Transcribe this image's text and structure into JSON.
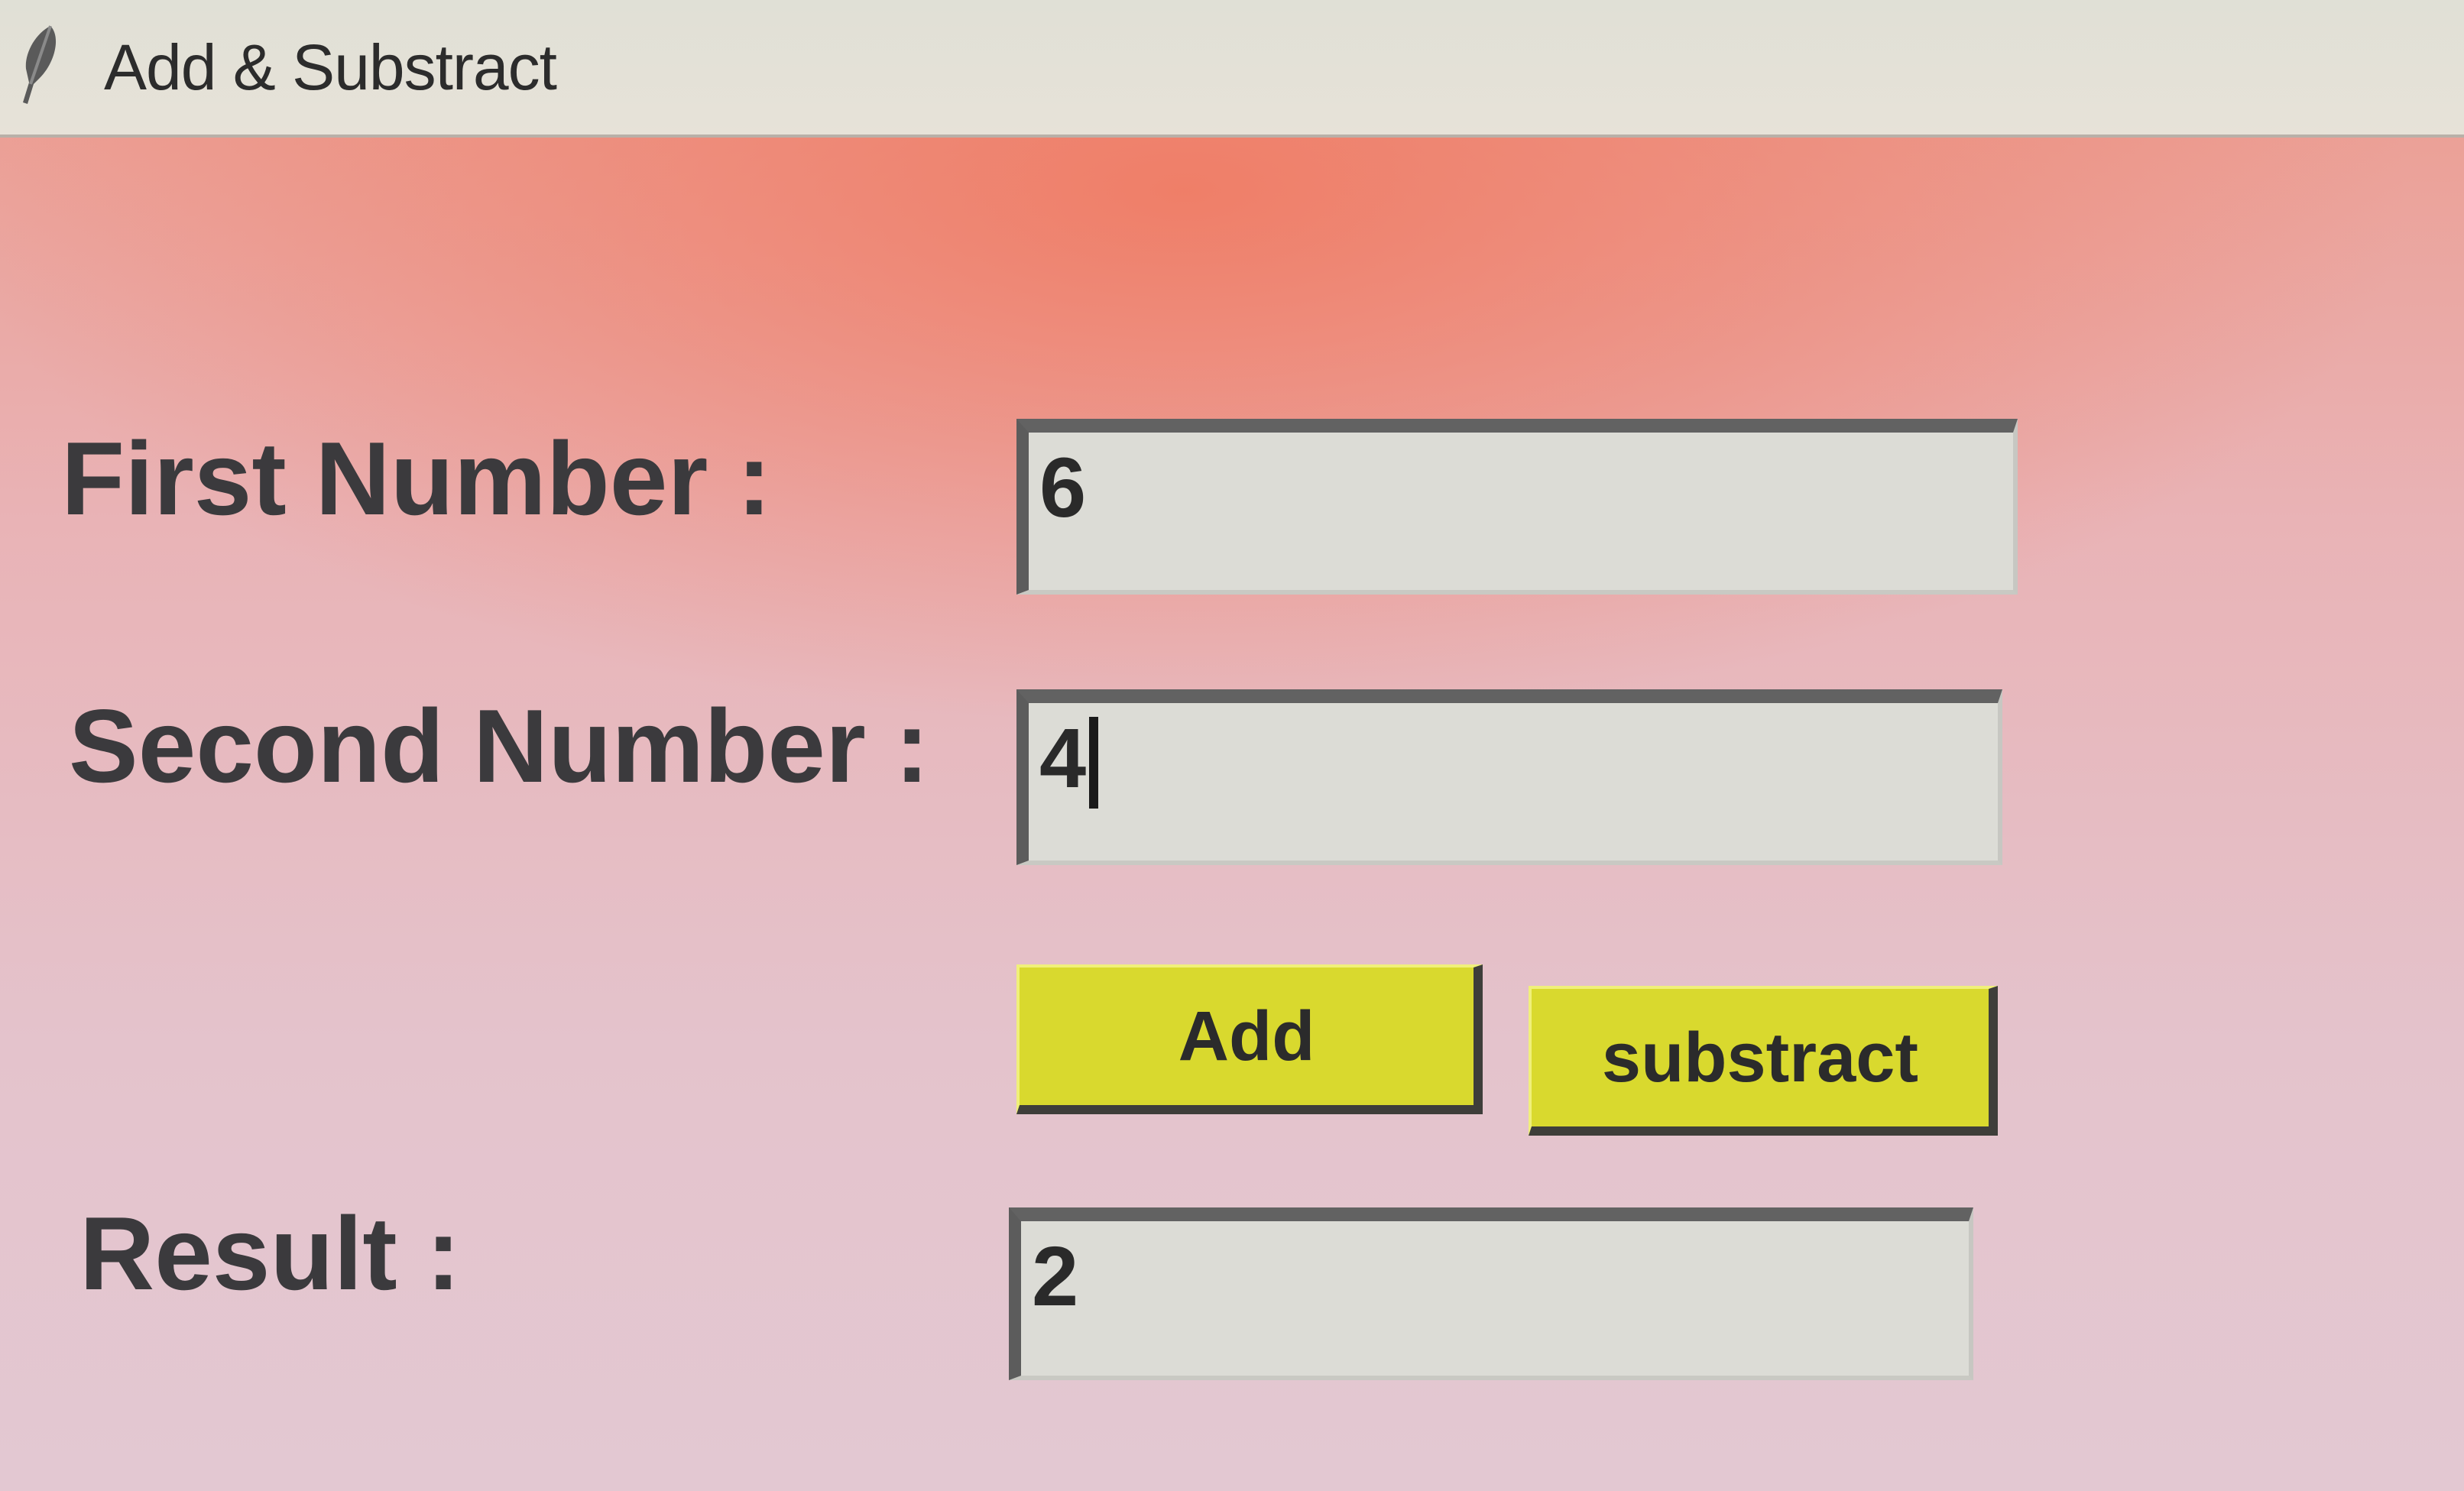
{
  "window": {
    "title": "Add & Substract",
    "icon": "feather-icon"
  },
  "form": {
    "first_label": "First Number :",
    "first_value": "6",
    "second_label": "Second Number :",
    "second_value": "4",
    "add_label": "Add",
    "subtract_label": "substract",
    "result_label": "Result :",
    "result_value": "2"
  },
  "colors": {
    "button": "#d9d92e",
    "background": "#e9b3b6",
    "entry": "#dcdcd6"
  }
}
